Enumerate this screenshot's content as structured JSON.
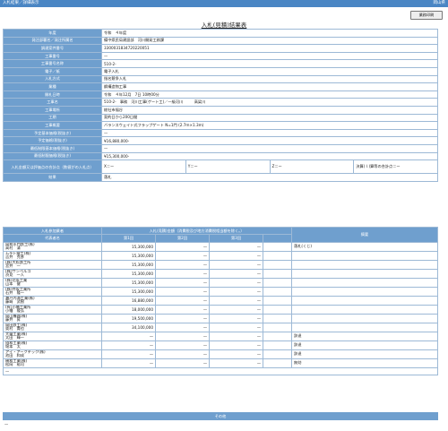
{
  "topbar": {
    "left": "入札結果／詳細表示",
    "right": "岡山県"
  },
  "print_button": "業務印刷",
  "title": "入札(見積)結果表",
  "info": [
    {
      "label": "年度",
      "value": "令和　４年度"
    },
    {
      "label": "発注部署名／発注所属名",
      "value": "備中県民局建設部　河川開発工務課"
    },
    {
      "label": "調達案件番号",
      "value": "3300031834720220051"
    },
    {
      "label": "工事番号",
      "value": "—"
    },
    {
      "label": "工事番号名称",
      "value": "510-2-"
    },
    {
      "label": "電子／紙",
      "value": "電子入札"
    },
    {
      "label": "入札方式",
      "value": "指名競争入札"
    },
    {
      "label": "業種",
      "value": "鋼構造物工事"
    },
    {
      "label": "開札日時",
      "value": "令和　４年12月　7日 10時00分"
    },
    {
      "label": "工事名",
      "value": "510-2-　事務　河川工事(ゲート工)／一級河川　　　高梁川"
    },
    {
      "label": "工事場所",
      "value": "総社市福谷"
    },
    {
      "label": "工期",
      "value": "契約日から200日間"
    },
    {
      "label": "工事概要",
      "value": "バランスウェイト式フラップゲート N=1門 (2.7m×1.3m)"
    },
    {
      "label": "予定基本価格(税抜き)",
      "value": "—"
    },
    {
      "label": "予定価格(税抜き)",
      "value": "¥16,880,000-"
    },
    {
      "label": "最低制限基本価格(税抜き)",
      "value": "—"
    },
    {
      "label": "最低制限価格(税抜き)",
      "value": "¥15,300,000-"
    }
  ],
  "score_row": {
    "label": "入札金額又は評価点の合計点（数値がの入札点）",
    "values": [
      "X＝ー",
      "Y＝ー",
      "Z＝ー",
      "決算(ｌ)算等の合計点＝ー"
    ]
  },
  "result_row": {
    "label": "結果",
    "value": "落札"
  },
  "bid_table": {
    "headers": {
      "participant": "入札参加業者",
      "amount_group": "入札(見積)金額（消費税及び地方消費税相当額を除く。）",
      "rep": "代表者名",
      "round1": "第1回",
      "round2": "第2回",
      "round3": "第3回",
      "remarks": "摘要"
    },
    "rows": [
      {
        "name1": "岡和水門鉄工(株)",
        "name2": "高村　清",
        "r1": "15,300,000",
        "r2": "—",
        "r3": "—",
        "note": "落札(くじ)"
      },
      {
        "name1": "ムラト鐵工(株)",
        "name2": "吉井　克彦",
        "r1": "15,300,000",
        "r2": "—",
        "r3": "—",
        "note": ""
      },
      {
        "name1": "(株)大松鉄工所",
        "name2": "宮井　一",
        "r1": "15,300,000",
        "r2": "—",
        "r3": "—",
        "note": ""
      },
      {
        "name1": "(株)サンペルコ",
        "name2": "渋見　一人",
        "r1": "15,300,000",
        "r2": "—",
        "r3": "—",
        "note": ""
      },
      {
        "name1": "(株)北条工業",
        "name2": "山本　健",
        "r1": "15,300,000",
        "r2": "—",
        "r3": "—",
        "note": ""
      },
      {
        "name1": "(株)井坂工業所",
        "name2": "石井　隆一",
        "r1": "15,300,000",
        "r2": "—",
        "r3": "—",
        "note": ""
      },
      {
        "name1": "瀬戸内海工業(株)",
        "name2": "藤崎　武樹",
        "r1": "16,880,000",
        "r2": "—",
        "r3": "—",
        "note": ""
      },
      {
        "name1": "(有)小幡工業所",
        "name2": "小幡　隆弘",
        "r1": "18,000,000",
        "r2": "—",
        "r3": "—",
        "note": ""
      },
      {
        "name1": "岡山機器(株)",
        "name2": "藤井　昇",
        "r1": "19,500,000",
        "r2": "—",
        "r3": "—",
        "note": ""
      },
      {
        "name1": "岡田鉄工(株)",
        "name2": "奥村　貴也",
        "r1": "34,100,000",
        "r2": "—",
        "r3": "—",
        "note": ""
      },
      {
        "name1": "大鐵工業(株)",
        "name2": "太田　輝一",
        "r1": "—",
        "r2": "—",
        "r3": "—",
        "note": "辞退"
      },
      {
        "name1": "協和工業(株)",
        "name2": "堀本　太",
        "r1": "—",
        "r2": "—",
        "r3": "—",
        "note": "辞退"
      },
      {
        "name1": "アイ・アークテック(株)",
        "name2": "池田　和成",
        "r1": "—",
        "r2": "—",
        "r3": "—",
        "note": "辞退"
      },
      {
        "name1": "横和工業(株)",
        "name2": "松岡　裕司",
        "r1": "—",
        "r2": "—",
        "r3": "—",
        "note": "無効"
      }
    ],
    "blank_row": "—"
  },
  "other": {
    "label": "その他",
    "value": "—"
  }
}
